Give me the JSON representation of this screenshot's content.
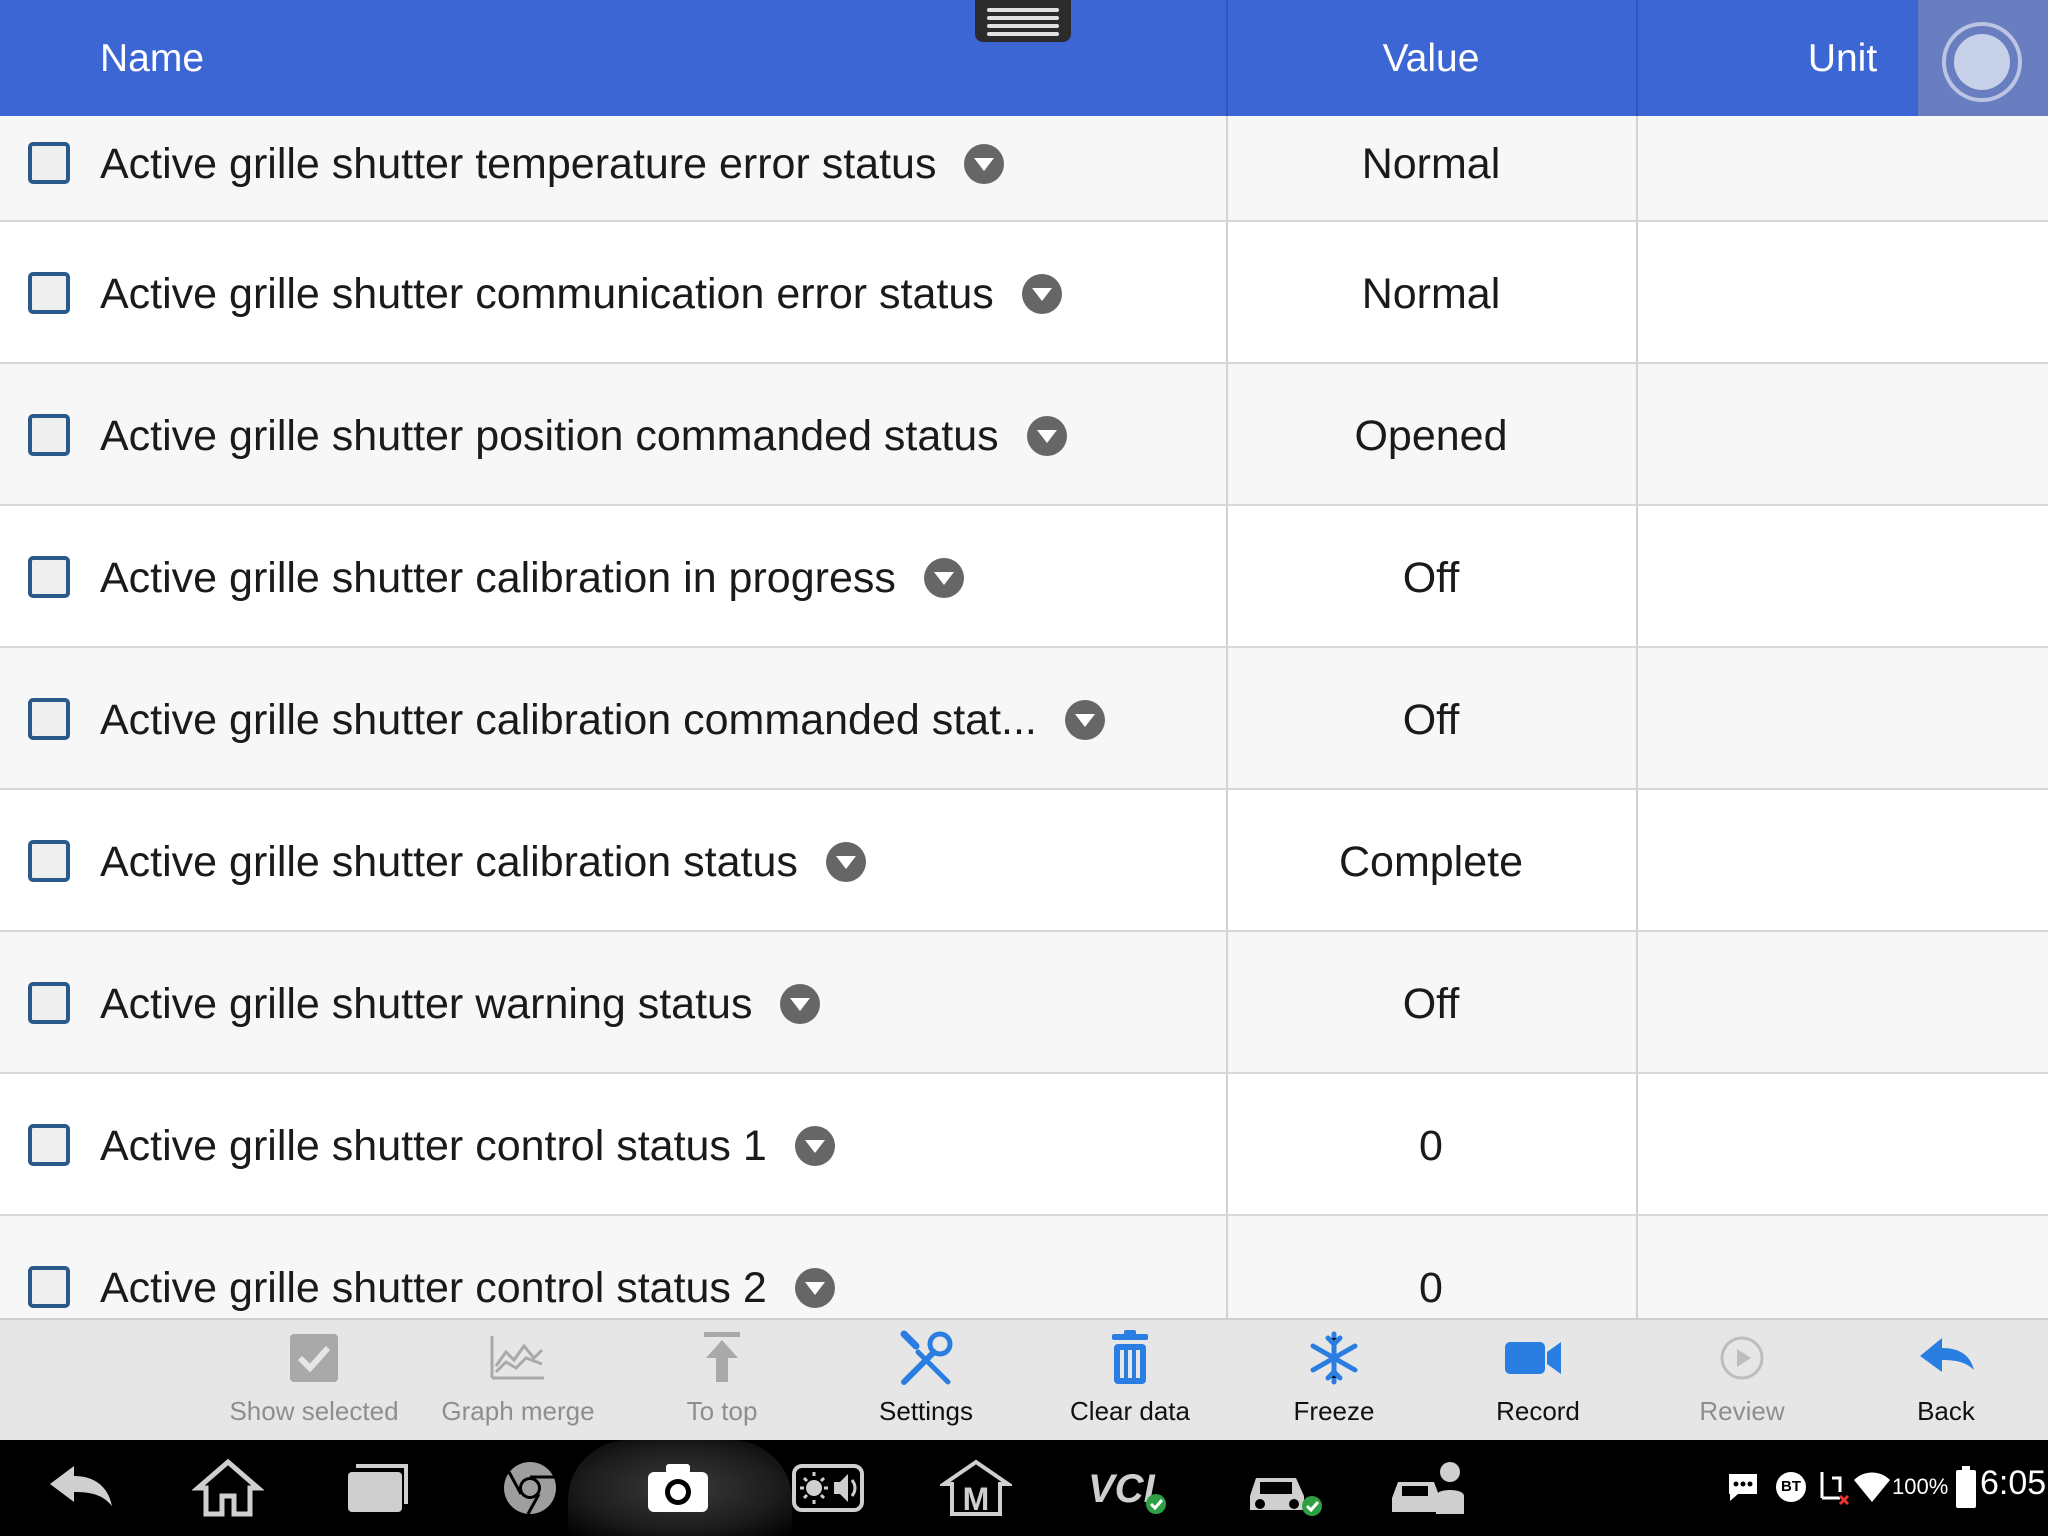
{
  "header": {
    "name_label": "Name",
    "value_label": "Value",
    "unit_label": "Unit"
  },
  "rows": [
    {
      "name": "Active grille shutter temperature error status",
      "value": "Normal",
      "unit": ""
    },
    {
      "name": "Active grille shutter communication error status",
      "value": "Normal",
      "unit": ""
    },
    {
      "name": "Active grille shutter position commanded status",
      "value": "Opened",
      "unit": ""
    },
    {
      "name": "Active grille shutter calibration in progress",
      "value": "Off",
      "unit": ""
    },
    {
      "name": "Active grille shutter calibration commanded stat...",
      "value": "Off",
      "unit": ""
    },
    {
      "name": "Active grille shutter calibration status",
      "value": "Complete",
      "unit": ""
    },
    {
      "name": "Active grille shutter warning status",
      "value": "Off",
      "unit": ""
    },
    {
      "name": "Active grille shutter control status 1",
      "value": "0",
      "unit": ""
    },
    {
      "name": "Active grille shutter control status 2",
      "value": "0",
      "unit": ""
    }
  ],
  "toolbar": {
    "show_selected": "Show selected",
    "graph_merge": "Graph merge",
    "to_top": "To top",
    "settings": "Settings",
    "clear_data": "Clear data",
    "freeze": "Freeze",
    "record": "Record",
    "review": "Review",
    "back": "Back"
  },
  "statusbar": {
    "battery": "100%",
    "time": "6:05",
    "bt": "BT",
    "vci": "VCI"
  },
  "icons": {
    "settings": "wrench-screwdriver-icon",
    "clear_data": "trash-icon",
    "freeze": "snowflake-icon",
    "record": "video-camera-icon",
    "back": "back-arrow-icon"
  },
  "colors": {
    "header_bg": "#3b66d4",
    "toolbar_bg": "#e6e6e6",
    "accent_icon": "#2a7de1",
    "checkbox_border": "#2a5a8a"
  }
}
